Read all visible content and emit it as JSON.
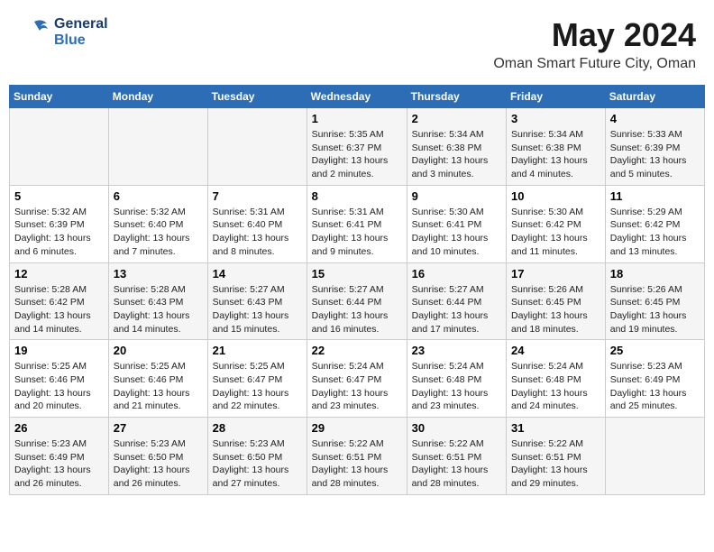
{
  "header": {
    "logo_line1": "General",
    "logo_line2": "Blue",
    "title": "May 2024",
    "subtitle": "Oman Smart Future City, Oman"
  },
  "days_of_week": [
    "Sunday",
    "Monday",
    "Tuesday",
    "Wednesday",
    "Thursday",
    "Friday",
    "Saturday"
  ],
  "weeks": [
    [
      {
        "day": "",
        "info": ""
      },
      {
        "day": "",
        "info": ""
      },
      {
        "day": "",
        "info": ""
      },
      {
        "day": "1",
        "info": "Sunrise: 5:35 AM\nSunset: 6:37 PM\nDaylight: 13 hours\nand 2 minutes."
      },
      {
        "day": "2",
        "info": "Sunrise: 5:34 AM\nSunset: 6:38 PM\nDaylight: 13 hours\nand 3 minutes."
      },
      {
        "day": "3",
        "info": "Sunrise: 5:34 AM\nSunset: 6:38 PM\nDaylight: 13 hours\nand 4 minutes."
      },
      {
        "day": "4",
        "info": "Sunrise: 5:33 AM\nSunset: 6:39 PM\nDaylight: 13 hours\nand 5 minutes."
      }
    ],
    [
      {
        "day": "5",
        "info": "Sunrise: 5:32 AM\nSunset: 6:39 PM\nDaylight: 13 hours\nand 6 minutes."
      },
      {
        "day": "6",
        "info": "Sunrise: 5:32 AM\nSunset: 6:40 PM\nDaylight: 13 hours\nand 7 minutes."
      },
      {
        "day": "7",
        "info": "Sunrise: 5:31 AM\nSunset: 6:40 PM\nDaylight: 13 hours\nand 8 minutes."
      },
      {
        "day": "8",
        "info": "Sunrise: 5:31 AM\nSunset: 6:41 PM\nDaylight: 13 hours\nand 9 minutes."
      },
      {
        "day": "9",
        "info": "Sunrise: 5:30 AM\nSunset: 6:41 PM\nDaylight: 13 hours\nand 10 minutes."
      },
      {
        "day": "10",
        "info": "Sunrise: 5:30 AM\nSunset: 6:42 PM\nDaylight: 13 hours\nand 11 minutes."
      },
      {
        "day": "11",
        "info": "Sunrise: 5:29 AM\nSunset: 6:42 PM\nDaylight: 13 hours\nand 13 minutes."
      }
    ],
    [
      {
        "day": "12",
        "info": "Sunrise: 5:28 AM\nSunset: 6:42 PM\nDaylight: 13 hours\nand 14 minutes."
      },
      {
        "day": "13",
        "info": "Sunrise: 5:28 AM\nSunset: 6:43 PM\nDaylight: 13 hours\nand 14 minutes."
      },
      {
        "day": "14",
        "info": "Sunrise: 5:27 AM\nSunset: 6:43 PM\nDaylight: 13 hours\nand 15 minutes."
      },
      {
        "day": "15",
        "info": "Sunrise: 5:27 AM\nSunset: 6:44 PM\nDaylight: 13 hours\nand 16 minutes."
      },
      {
        "day": "16",
        "info": "Sunrise: 5:27 AM\nSunset: 6:44 PM\nDaylight: 13 hours\nand 17 minutes."
      },
      {
        "day": "17",
        "info": "Sunrise: 5:26 AM\nSunset: 6:45 PM\nDaylight: 13 hours\nand 18 minutes."
      },
      {
        "day": "18",
        "info": "Sunrise: 5:26 AM\nSunset: 6:45 PM\nDaylight: 13 hours\nand 19 minutes."
      }
    ],
    [
      {
        "day": "19",
        "info": "Sunrise: 5:25 AM\nSunset: 6:46 PM\nDaylight: 13 hours\nand 20 minutes."
      },
      {
        "day": "20",
        "info": "Sunrise: 5:25 AM\nSunset: 6:46 PM\nDaylight: 13 hours\nand 21 minutes."
      },
      {
        "day": "21",
        "info": "Sunrise: 5:25 AM\nSunset: 6:47 PM\nDaylight: 13 hours\nand 22 minutes."
      },
      {
        "day": "22",
        "info": "Sunrise: 5:24 AM\nSunset: 6:47 PM\nDaylight: 13 hours\nand 23 minutes."
      },
      {
        "day": "23",
        "info": "Sunrise: 5:24 AM\nSunset: 6:48 PM\nDaylight: 13 hours\nand 23 minutes."
      },
      {
        "day": "24",
        "info": "Sunrise: 5:24 AM\nSunset: 6:48 PM\nDaylight: 13 hours\nand 24 minutes."
      },
      {
        "day": "25",
        "info": "Sunrise: 5:23 AM\nSunset: 6:49 PM\nDaylight: 13 hours\nand 25 minutes."
      }
    ],
    [
      {
        "day": "26",
        "info": "Sunrise: 5:23 AM\nSunset: 6:49 PM\nDaylight: 13 hours\nand 26 minutes."
      },
      {
        "day": "27",
        "info": "Sunrise: 5:23 AM\nSunset: 6:50 PM\nDaylight: 13 hours\nand 26 minutes."
      },
      {
        "day": "28",
        "info": "Sunrise: 5:23 AM\nSunset: 6:50 PM\nDaylight: 13 hours\nand 27 minutes."
      },
      {
        "day": "29",
        "info": "Sunrise: 5:22 AM\nSunset: 6:51 PM\nDaylight: 13 hours\nand 28 minutes."
      },
      {
        "day": "30",
        "info": "Sunrise: 5:22 AM\nSunset: 6:51 PM\nDaylight: 13 hours\nand 28 minutes."
      },
      {
        "day": "31",
        "info": "Sunrise: 5:22 AM\nSunset: 6:51 PM\nDaylight: 13 hours\nand 29 minutes."
      },
      {
        "day": "",
        "info": ""
      }
    ]
  ]
}
